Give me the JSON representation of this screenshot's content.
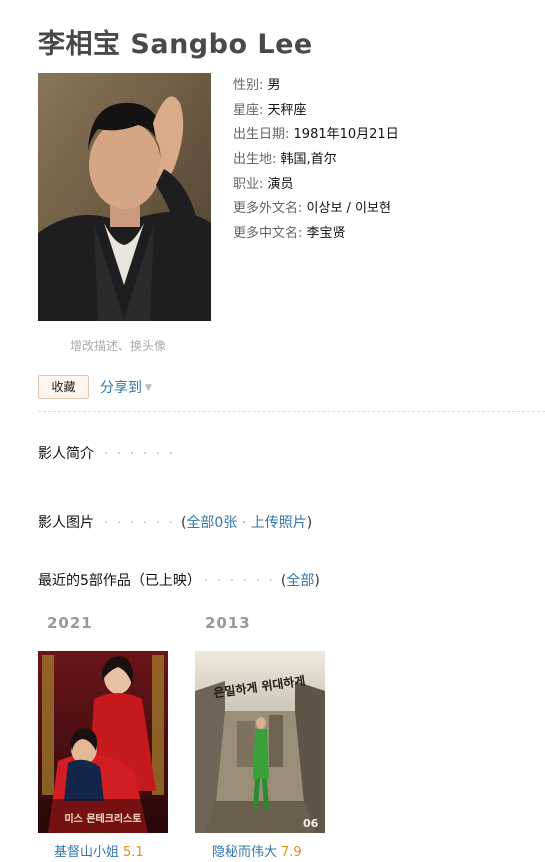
{
  "person": {
    "name_cn": "李相宝",
    "name_en": "Sangbo Lee"
  },
  "info": [
    {
      "key": "性别:",
      "value": "男"
    },
    {
      "key": "星座:",
      "value": "天秤座"
    },
    {
      "key": "出生日期:",
      "value": "1981年10月21日"
    },
    {
      "key": "出生地:",
      "value": "韩国,首尔"
    },
    {
      "key": "职业:",
      "value": "演员"
    },
    {
      "key": "更多外文名:",
      "value": "이상보 / 이보현"
    },
    {
      "key": "更多中文名:",
      "value": "李宝贤"
    }
  ],
  "edit_links": "增改描述、换头像",
  "actions": {
    "collect": "收藏",
    "share": "分享到"
  },
  "sections": {
    "intro": {
      "title": "影人简介",
      "dots": "· · · · · ·"
    },
    "photos": {
      "title": "影人图片",
      "dots": "· · · · · ·",
      "open": "(",
      "all": "全部0张",
      "sep": "·",
      "upload": "上传照片",
      "close": ")"
    },
    "works": {
      "title": "最近的5部作品（已上映）",
      "dots": "· · · · · ·",
      "open": "(",
      "all": "全部",
      "close": ")"
    }
  },
  "works": [
    {
      "year": "2021",
      "title": "基督山小姐",
      "rating": "5.1",
      "poster_text": "미스 몬테크리스토"
    },
    {
      "year": "2013",
      "title": "隐秘而伟大",
      "rating": "7.9",
      "poster_text": "은밀하게 위대하게",
      "poster_badge": "06"
    }
  ],
  "colors": {
    "link": "#3377aa",
    "rating": "#e09015",
    "muted": "#999999"
  }
}
